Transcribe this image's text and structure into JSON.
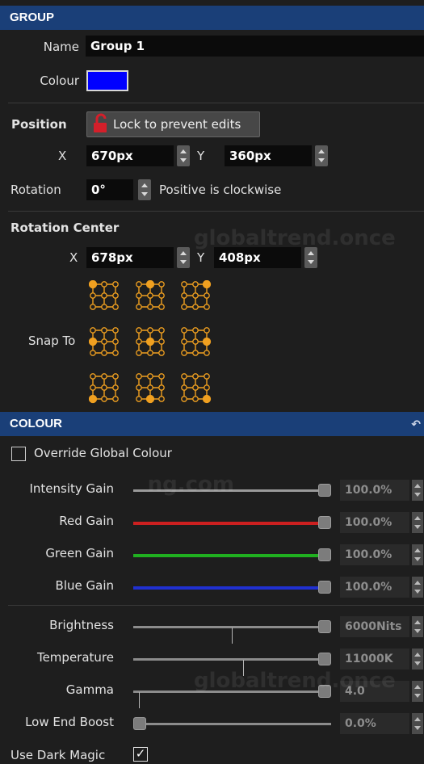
{
  "group": {
    "header": "GROUP",
    "name_label": "Name",
    "name_value": "Group 1",
    "colour_label": "Colour",
    "colour_value": "#0000ff"
  },
  "position": {
    "title": "Position",
    "lock_button": "Lock to prevent edits",
    "x_label": "X",
    "x_value": "670px",
    "y_label": "Y",
    "y_value": "360px",
    "rotation_label": "Rotation",
    "rotation_value": "0°",
    "rotation_note": "Positive is clockwise"
  },
  "rotation_center": {
    "title": "Rotation Center",
    "x_label": "X",
    "x_value": "678px",
    "y_label": "Y",
    "y_value": "408px",
    "snap_label": "Snap To",
    "snap_points": [
      "top-left",
      "top-center",
      "top-right",
      "middle-left",
      "center",
      "middle-right",
      "bottom-left",
      "bottom-center",
      "bottom-right"
    ],
    "accent_color": "#f0a020"
  },
  "colour": {
    "header": "COLOUR",
    "override_label": "Override Global Colour",
    "override_checked": false,
    "sliders": [
      {
        "label": "Intensity Gain",
        "value": "100.0%",
        "level": 1.0,
        "color": "#9a9a9a"
      },
      {
        "label": "Red Gain",
        "value": "100.0%",
        "level": 1.0,
        "color": "#cc2020"
      },
      {
        "label": "Green Gain",
        "value": "100.0%",
        "level": 1.0,
        "color": "#20b020"
      },
      {
        "label": "Blue Gain",
        "value": "100.0%",
        "level": 1.0,
        "color": "#2030d0"
      }
    ],
    "sliders2": [
      {
        "label": "Brightness",
        "value": "6000Nits",
        "level": 1.0
      },
      {
        "label": "Temperature",
        "value": "11000K",
        "level": 1.0
      },
      {
        "label": "Gamma",
        "value": "4.0",
        "level": 1.0
      },
      {
        "label": "Low End Boost",
        "value": "0.0%",
        "level": 0.0
      }
    ],
    "dark_magic_label": "Use Dark Magic",
    "dark_magic_checked": true,
    "dark_magic_mark": "✓"
  },
  "watermarks": [
    "globaltrend.once",
    "ng.com",
    "globaltrend.once"
  ]
}
